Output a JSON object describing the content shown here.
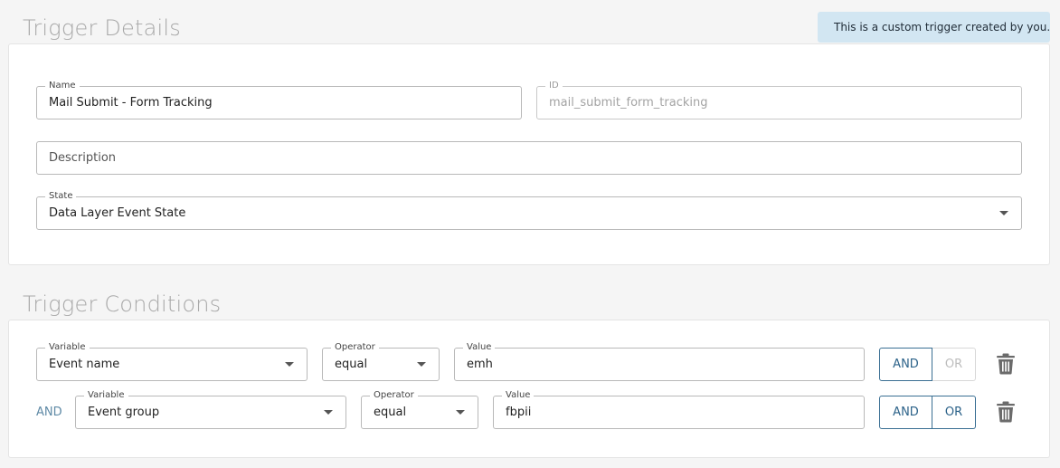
{
  "details": {
    "title": "Trigger Details",
    "notice": "This is a custom trigger created by you.",
    "name": {
      "label": "Name",
      "value": "Mail Submit - Form Tracking"
    },
    "id": {
      "label": "ID",
      "value": "mail_submit_form_tracking"
    },
    "description": {
      "placeholder": "Description"
    },
    "state": {
      "label": "State",
      "value": "Data Layer Event State"
    }
  },
  "conditions": {
    "title": "Trigger Conditions",
    "rows": [
      {
        "prefix": "",
        "variable": {
          "label": "Variable",
          "value": "Event name"
        },
        "operator": {
          "label": "Operator",
          "value": "equal"
        },
        "value": {
          "label": "Value",
          "value": "emh"
        },
        "and_label": "AND",
        "or_label": "OR",
        "or_enabled": false
      },
      {
        "prefix": "AND",
        "variable": {
          "label": "Variable",
          "value": "Event group"
        },
        "operator": {
          "label": "Operator",
          "value": "equal"
        },
        "value": {
          "label": "Value",
          "value": "fbpii"
        },
        "and_label": "AND",
        "or_label": "OR",
        "or_enabled": true
      }
    ]
  },
  "colors": {
    "accent": "#2c6289",
    "notice_bg": "#d2e6f2",
    "check_badge": "#1d5f9a"
  },
  "icons": {
    "notice": "check-badge-icon",
    "dropdown": "chevron-down-icon",
    "delete": "trash-icon"
  }
}
